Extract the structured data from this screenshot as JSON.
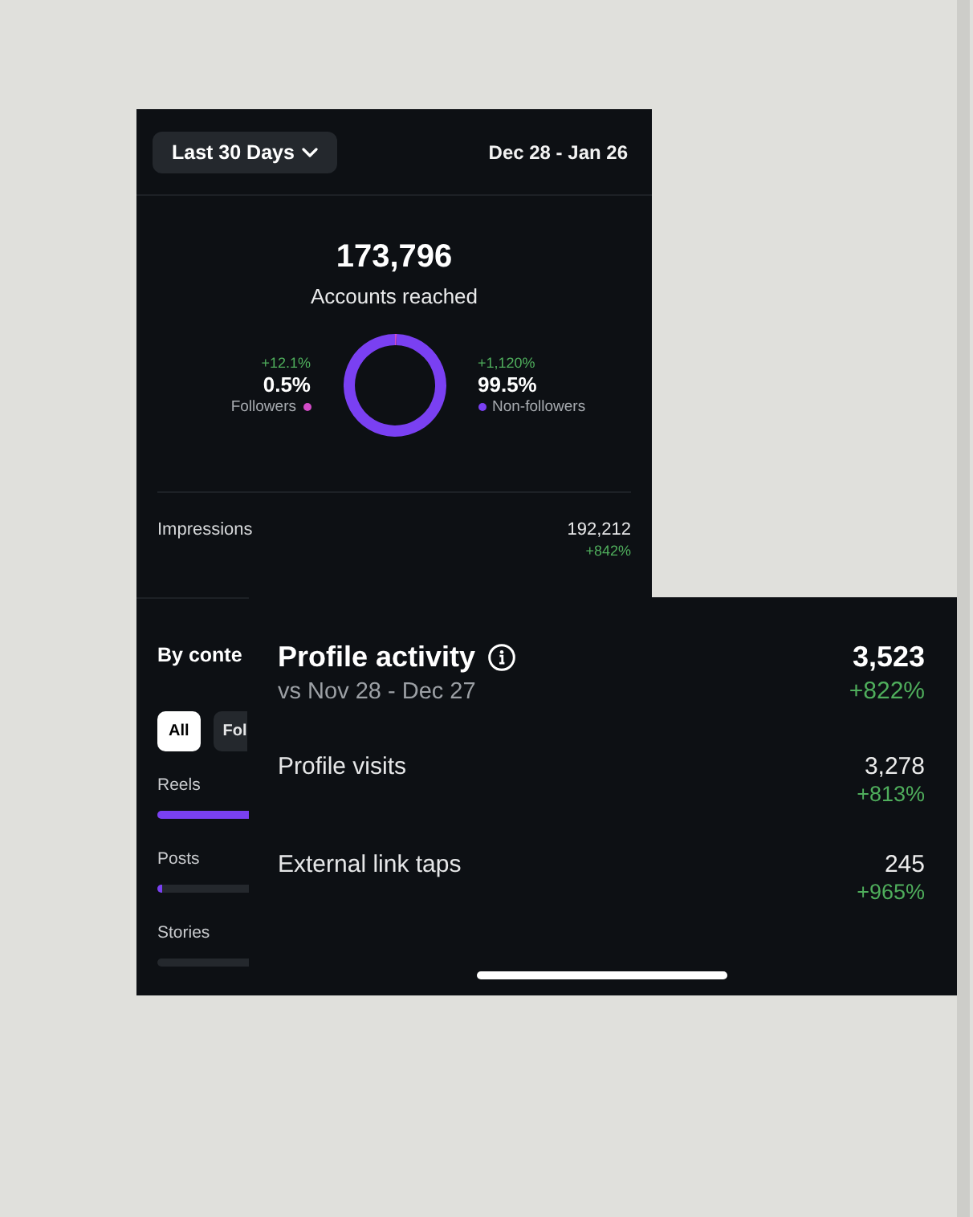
{
  "period_picker": {
    "label": "Last 30 Days"
  },
  "date_range": "Dec 28 - Jan 26",
  "reach": {
    "total": "173,796",
    "caption": "Accounts reached",
    "segments": [
      {
        "change": "+12.1%",
        "share": "0.5%",
        "label": "Followers",
        "color": "#d24bc8"
      },
      {
        "change": "+1,120%",
        "share": "99.5%",
        "label": "Non-followers",
        "color": "#7a40f2"
      }
    ],
    "chart_data": {
      "type": "donut",
      "values": [
        0.5,
        99.5
      ]
    }
  },
  "metrics": [
    {
      "label": "Impressions",
      "value": "192,212",
      "change": "+842%"
    }
  ],
  "by_content": {
    "title": "By conte",
    "filters": [
      {
        "label": "All",
        "selected": true
      },
      {
        "label": "Fol",
        "selected": false
      }
    ],
    "types": [
      {
        "label": "Reels",
        "level": 1
      },
      {
        "label": "Posts",
        "level": 0.05
      },
      {
        "label": "Stories",
        "level": 0
      }
    ]
  },
  "profile_activity": {
    "title": "Profile activity",
    "subtitle": "vs Nov 28 - Dec 27",
    "value": "3,523",
    "change": "+822%",
    "rows": [
      {
        "label": "Profile visits",
        "value": "3,278",
        "change": "+813%"
      },
      {
        "label": "External link taps",
        "value": "245",
        "change": "+965%"
      }
    ]
  }
}
